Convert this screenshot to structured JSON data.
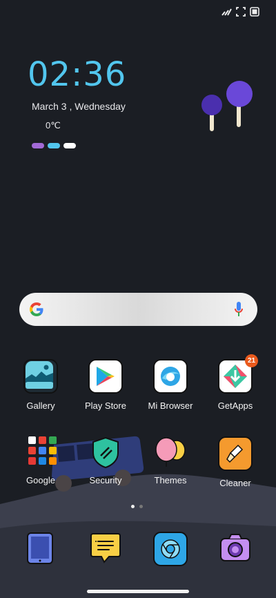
{
  "status_bar": {
    "icons": [
      "signal-icon",
      "screenshot-frame-icon",
      "battery-icon"
    ]
  },
  "clock_widget": {
    "time": "02:36",
    "date": "March  3 , Wednesday",
    "temperature": "0℃",
    "indicator_colors": [
      "#a26ad6",
      "#52c6ee",
      "#ffffff"
    ]
  },
  "search_bar": {
    "logo": "google-g-icon",
    "mic": "microphone-icon"
  },
  "apps": [
    {
      "label": "Gallery",
      "icon": "gallery-icon"
    },
    {
      "label": "Play Store",
      "icon": "play-store-icon"
    },
    {
      "label": "Mi Browser",
      "icon": "mi-browser-icon"
    },
    {
      "label": "GetApps",
      "icon": "getapps-icon",
      "badge": "21"
    },
    {
      "label": "Google",
      "icon": "google-folder-icon"
    },
    {
      "label": "Security",
      "icon": "security-icon"
    },
    {
      "label": "Themes",
      "icon": "themes-icon"
    },
    {
      "label": "Cleaner",
      "icon": "cleaner-icon"
    }
  ],
  "page_indicator": {
    "pages": 2,
    "current": 1
  },
  "dock": [
    "tablet-icon",
    "messages-icon",
    "chrome-icon",
    "camera-icon"
  ],
  "colors": {
    "background": "#1b1e24",
    "clock": "#52c6ee",
    "badge": "#e95a1d"
  }
}
